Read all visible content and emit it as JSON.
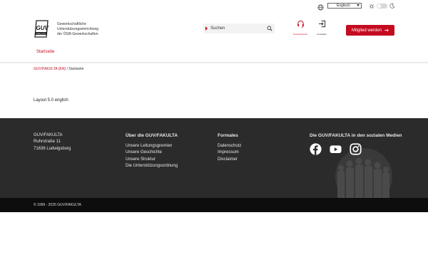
{
  "topbar": {
    "language_selected": "Englisch",
    "colors": {
      "accent": "#c40b20"
    }
  },
  "header": {
    "logo_text": "GUV",
    "logo_subtext": "FAKULTA",
    "org_lines": [
      "Gewerkschaftliche",
      "Unterstützungseinrichtung",
      "der ÖGB-Gewerkschaften"
    ],
    "search_placeholder": "Suchen",
    "service_label": "Servicebereich",
    "login_label": "Anmelden",
    "member_button": "Mitglied werden",
    "nav_start": "Startseite"
  },
  "breadcrumb": {
    "link": "GUV/FAKULTA (EN)",
    "separator": "/",
    "current": "Startseite"
  },
  "main": {
    "text": "Layout 5.0 english"
  },
  "footer": {
    "address": {
      "name": "GUV/FAKULTA",
      "street": "Ruhrstraße 11",
      "city": "71636 Ludwigsburg"
    },
    "about": {
      "title": "Über die GUV/FAKULTA",
      "links": [
        "Unsere Leitungsgremien",
        "Unsere Geschichte",
        "Unsere Struktur",
        "Die Unterstützungsordnung"
      ]
    },
    "formal": {
      "title": "Formales",
      "links": [
        "Datenschutz",
        "Impressum",
        "Disclaimer"
      ]
    },
    "social": {
      "title": "Die GUV/FAKULTA in den sozialen Medien",
      "icons": [
        "facebook-icon",
        "youtube-icon",
        "instagram-icon"
      ]
    },
    "copyright": "© 1999 - 2025 GUV/FAKULTA"
  }
}
